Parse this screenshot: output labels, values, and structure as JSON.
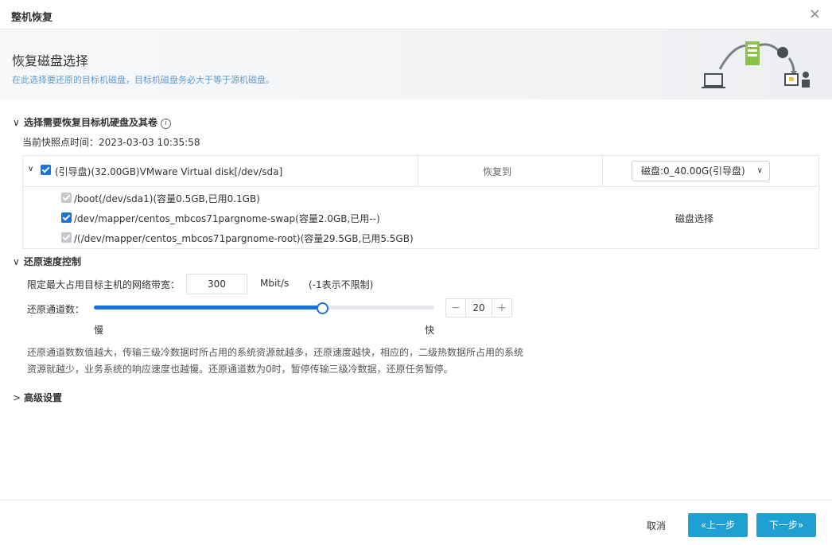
{
  "window": {
    "title": "整机恢复",
    "close_glyph": "×"
  },
  "header": {
    "title": "恢复磁盘选择",
    "description": "在此选择要还原的目标机磁盘，目标机磁盘务必大于等于源机磁盘。"
  },
  "disk_section": {
    "title": "选择需要恢复目标机硬盘及其卷",
    "info_glyph": "i",
    "snapshot_time": "当前快照点时间：2023-03-03 10:35:58",
    "disk": {
      "label": "(引导盘)(32.00GB)VMware Virtual disk[/dev/sda]",
      "checked": true,
      "restore_to": "恢复到",
      "target_select": "磁盘:0_40.00G(引导盘)"
    },
    "volumes": [
      {
        "label": "/boot(/dev/sda1)(容量0.5GB,已用0.1GB)",
        "checked": true,
        "disabled": true
      },
      {
        "label": "/dev/mapper/centos_mbcos71pargnome-swap(容量2.0GB,已用--)",
        "checked": true,
        "disabled": false
      },
      {
        "label": "/(/dev/mapper/centos_mbcos71pargnome-root)(容量29.5GB,已用5.5GB)",
        "checked": true,
        "disabled": true
      }
    ],
    "disk_select_label": "磁盘选择"
  },
  "speed_section": {
    "title": "还原速度控制",
    "bandwidth_label": "限定最大占用目标主机的网络带宽：",
    "bandwidth_value": "300",
    "bandwidth_unit": "Mbit/s",
    "bandwidth_hint": "(-1表示不限制)",
    "channels_label": "还原通道数：",
    "channels_value": "20",
    "channels_fraction": 0.67,
    "slow_label": "慢",
    "fast_label": "快",
    "explanation_line1": "还原通道数数值越大，传输三级冷数据时所占用的系统资源就越多，还原速度越快，相应的，二级热数据所占用的系统",
    "explanation_line2": "资源就越少，业务系统的响应速度也越慢。还原通道数为0时，暂停传输三级冷数据，还原任务暂停。"
  },
  "advanced_section": {
    "title": "高级设置"
  },
  "footer": {
    "cancel": "取消",
    "prev": "«上一步",
    "next": "下一步»"
  },
  "colors": {
    "primary_button": "#1ea0d2",
    "slider_fill": "#1a73d9",
    "checkbox": "#1a73d9",
    "header_desc": "#5b9bd5"
  }
}
